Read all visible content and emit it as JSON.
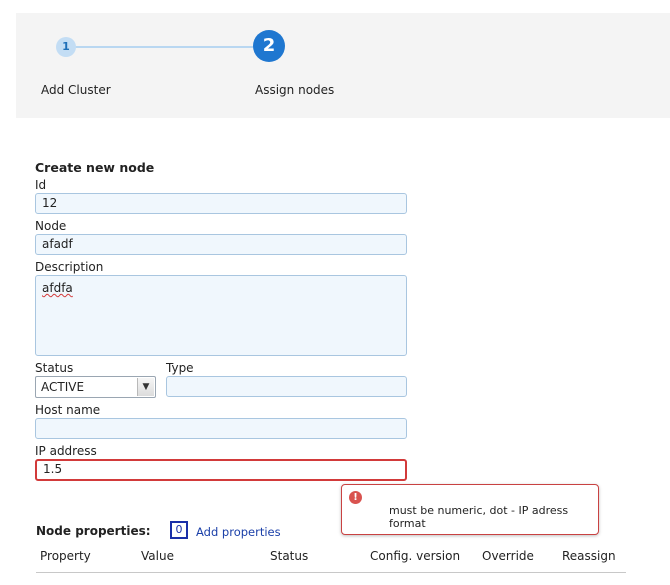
{
  "wizard": {
    "steps": [
      {
        "number": "1",
        "label": "Add Cluster"
      },
      {
        "number": "2",
        "label": "Assign nodes"
      }
    ]
  },
  "form": {
    "title": "Create new node",
    "id": {
      "label": "Id",
      "value": "12"
    },
    "node": {
      "label": "Node",
      "value": "afadf"
    },
    "description": {
      "label": "Description",
      "value": "afdfa"
    },
    "status": {
      "label": "Status",
      "value": "ACTIVE"
    },
    "type": {
      "label": "Type",
      "value": ""
    },
    "host_name": {
      "label": "Host name",
      "value": ""
    },
    "ip_address": {
      "label": "IP address",
      "value": "1.5"
    },
    "ip_error": {
      "icon": "error-icon",
      "message": "must be numeric, dot - IP adress format"
    }
  },
  "node_properties": {
    "title": "Node properties:",
    "count": "0",
    "add_link": "Add properties",
    "columns": [
      "Property",
      "Value",
      "Status",
      "Config. version",
      "Override",
      "Reassign"
    ]
  },
  "colors": {
    "accent": "#1f77d0",
    "error": "#d23a3a"
  }
}
